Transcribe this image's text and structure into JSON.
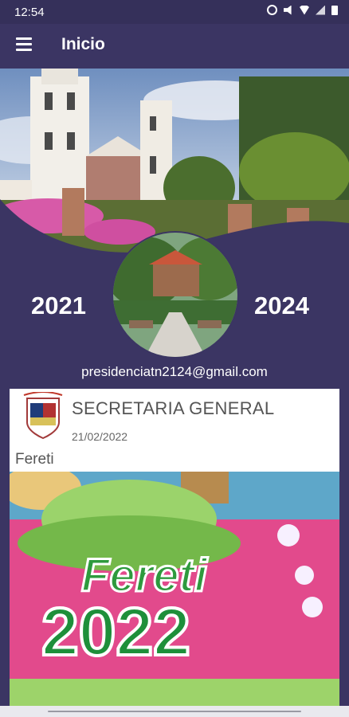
{
  "status_bar": {
    "time": "12:54"
  },
  "app_bar": {
    "title": "Inicio"
  },
  "header": {
    "year_start": "2021",
    "year_end": "2024",
    "email": "presidenciatn2124@gmail.com"
  },
  "post": {
    "author": "SECRETARIA GENERAL",
    "date": "21/02/2022",
    "text": "Fereti",
    "poster_title": "Fereti",
    "poster_year": "2022"
  },
  "colors": {
    "primary": "#3b3563",
    "card": "#ffffff"
  }
}
